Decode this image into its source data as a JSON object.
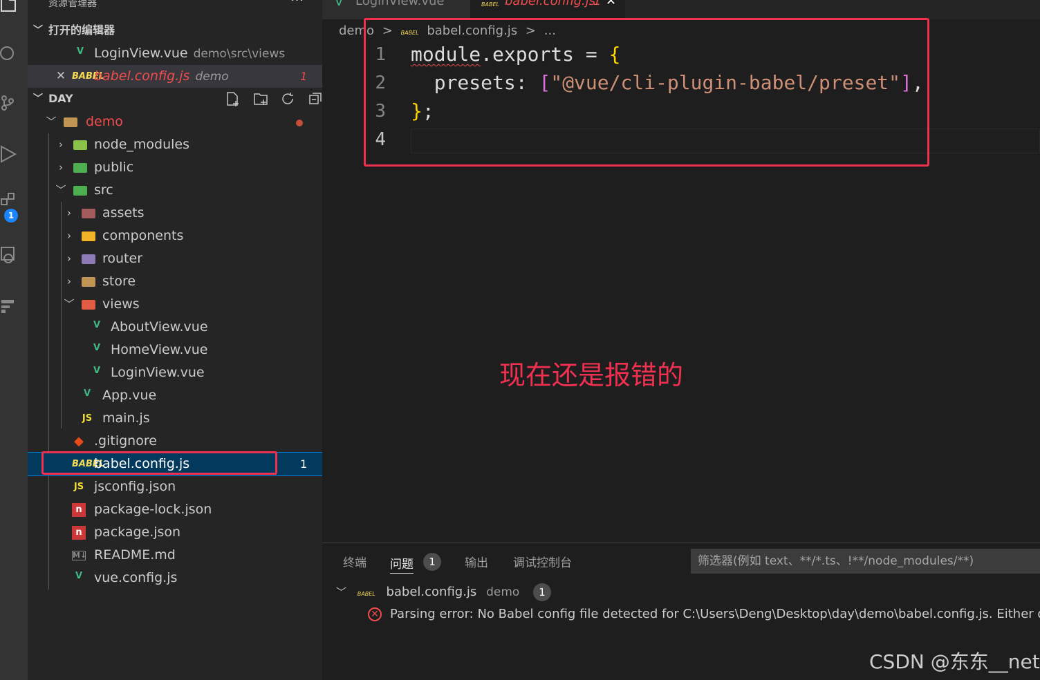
{
  "sidebar": {
    "title": "资源管理器",
    "title_more": "···",
    "open_editors": {
      "header": "打开的编辑器",
      "items": [
        {
          "icon": "vue-icon",
          "name": "LoginView.vue",
          "desc": "demo\\src\\views"
        },
        {
          "close": "✕",
          "icon": "babel-icon",
          "name": "babel.config.js",
          "desc": "demo",
          "count": "1"
        }
      ]
    },
    "workspace": {
      "header": "DAY",
      "root": "demo",
      "items": [
        {
          "name": "node_modules"
        },
        {
          "name": "public"
        },
        {
          "name": "src"
        },
        {
          "name": "assets"
        },
        {
          "name": "components"
        },
        {
          "name": "router"
        },
        {
          "name": "store"
        },
        {
          "name": "views"
        },
        {
          "name": "AboutView.vue"
        },
        {
          "name": "HomeView.vue"
        },
        {
          "name": "LoginView.vue"
        },
        {
          "name": "App.vue"
        },
        {
          "name": "main.js"
        },
        {
          "name": ".gitignore"
        },
        {
          "name": "babel.config.js",
          "count": "1"
        },
        {
          "name": "jsconfig.json"
        },
        {
          "name": "package-lock.json"
        },
        {
          "name": "package.json"
        },
        {
          "name": "README.md"
        },
        {
          "name": "vue.config.js"
        }
      ]
    }
  },
  "activity_badge": "1",
  "tabs": [
    {
      "icon": "vue-icon",
      "label": "LoginView.vue"
    },
    {
      "icon": "babel-icon",
      "label": "babel.config.js",
      "count": "1",
      "close": "✕"
    }
  ],
  "breadcrumb": [
    "demo",
    ">",
    "babel.config.js",
    ">",
    "..."
  ],
  "editor": {
    "line_numbers": [
      "1",
      "2",
      "3",
      "4"
    ],
    "lines": {
      "l1a": "module",
      "l1b": ".exports = ",
      "l1c": "{",
      "l2a": "  presets: ",
      "l2b": "[",
      "l2c": "\"@vue/cli-plugin-babel/preset\"",
      "l2d": "]",
      "l2e": ",",
      "l3a": "}",
      "l3b": ";"
    }
  },
  "annotation": "现在还是报错的",
  "panel": {
    "tabs": [
      "终端",
      "问题",
      "输出",
      "调试控制台"
    ],
    "problems_count": "1",
    "filter_placeholder": "筛选器(例如 text、**/*.ts、!**/node_modules/**)",
    "problem_file": "babel.config.js",
    "problem_folder": "demo",
    "problem_file_count": "1",
    "problem_message": "Parsing error: No Babel config file detected for C:\\Users\\Deng\\Desktop\\day\\demo\\babel.config.js. Either disab"
  },
  "watermark": "CSDN @东东__net",
  "colors": {
    "accent": "#007fd4",
    "error": "#f14c4c",
    "annotation": "#f03050"
  }
}
